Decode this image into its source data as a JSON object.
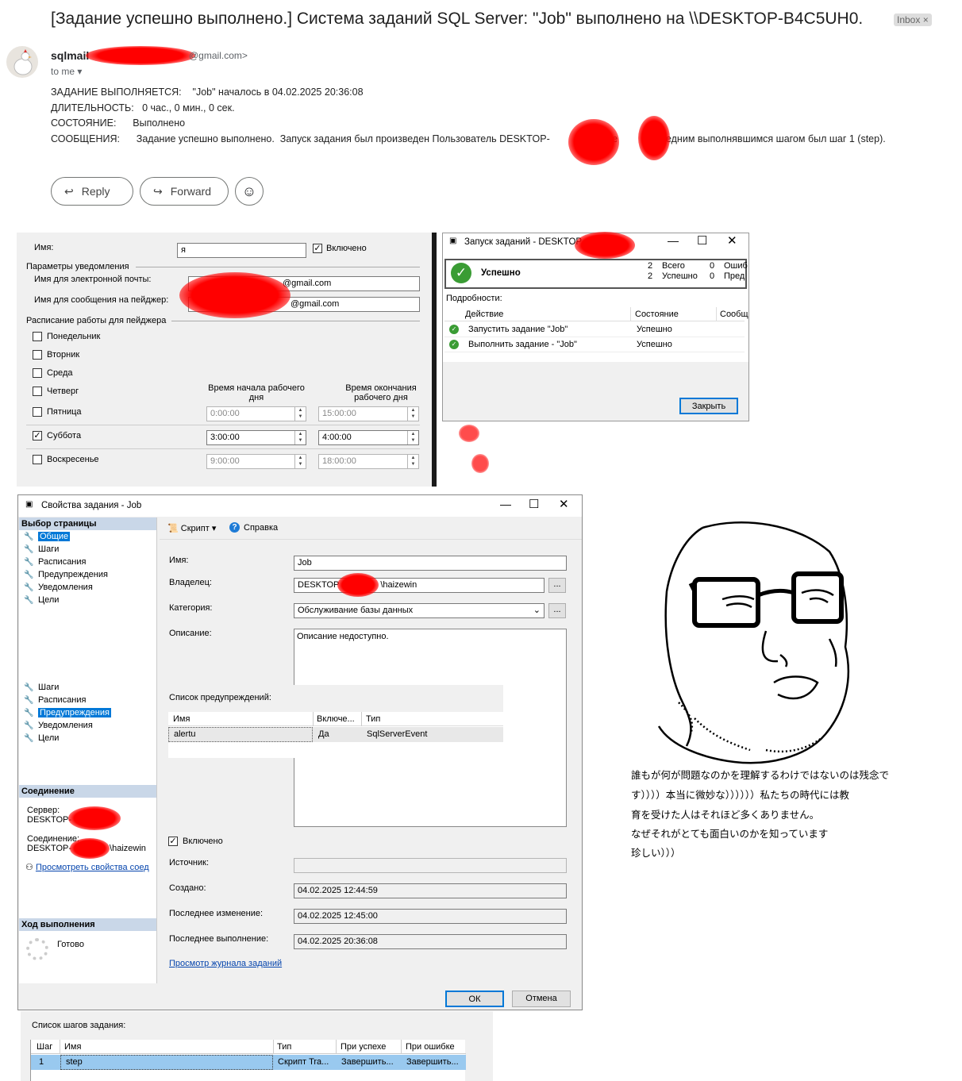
{
  "email": {
    "subject": "[Задание успешно выполнено.] Система заданий SQL Server: \"Job\" выполнено на \\\\DESKTOP-B4C5UH0.",
    "badge": "Inbox ×",
    "sender_name": "sqlmail",
    "sender_domain": "@gmail.com>",
    "to": "to me",
    "lines": [
      "ЗАДАНИЕ ВЫПОЛНЯЕТСЯ:    \"Job\" началось в 04.02.2025 20:36:08",
      "ДЛИТЕЛЬНОСТЬ:   0 час., 0 мин., 0 сек.",
      "СОСТОЯНИЕ:      Выполнено",
      "СООБЩЕНИЯ:      Задание успешно выполнено.  Запуск задания был произведен Пользователь DESKTOP-                haize         Последним выполнявшимся шагом был шаг 1 (step)."
    ],
    "reply": "Reply",
    "forward": "Forward"
  },
  "operator": {
    "name_label": "Имя:",
    "name_value": "я",
    "enabled": "Включено",
    "notify_group": "Параметры уведомления",
    "email_label": "Имя для электронной почты:",
    "email_value": "@gmail.com",
    "pager_label": "Имя для сообщения на пейджер:",
    "pager_value": "@gmail.com",
    "schedule_group": "Расписание работы для пейджера",
    "days": [
      "Понедельник",
      "Вторник",
      "Среда",
      "Четверг",
      "Пятница",
      "Суббота",
      "Воскресенье"
    ],
    "start_header": "Время начала рабочего дня",
    "end_header": "Время окончания рабочего дня",
    "rows": [
      {
        "start": "0:00:00",
        "end": "15:00:00"
      },
      {
        "start": "3:00:00",
        "end": "4:00:00"
      },
      {
        "start": "9:00:00",
        "end": "18:00:00"
      }
    ]
  },
  "run": {
    "title": "Запуск заданий - DESKTOP-",
    "status": "Успешно",
    "counts": [
      [
        "2",
        "Всего",
        "0",
        "Ошиб"
      ],
      [
        "2",
        "Успешно",
        "0",
        "Пред"
      ]
    ],
    "details": "Подробности:",
    "cols": [
      "Действие",
      "Состояние",
      "Сообщ"
    ],
    "rows": [
      [
        "Запустить задание \"Job\"",
        "Успешно"
      ],
      [
        "Выполнить задание - \"Job\"",
        "Успешно"
      ]
    ],
    "close": "Закрыть"
  },
  "props": {
    "title": "Свойства задания - Job",
    "nav_header": "Выбор страницы",
    "nav": [
      "Общие",
      "Шаги",
      "Расписания",
      "Предупреждения",
      "Уведомления",
      "Цели"
    ],
    "nav2": [
      "Шаги",
      "Расписания",
      "Предупреждения",
      "Уведомления",
      "Цели"
    ],
    "script": "Скрипт",
    "help": "Справка",
    "name_label": "Имя:",
    "name_value": "Job",
    "owner_label": "Владелец:",
    "owner_value_a": "DESKTOP",
    "owner_value_b": "\\haizewin",
    "category_label": "Категория:",
    "category_value": "Обслуживание базы данных",
    "desc_label": "Описание:",
    "desc_value": "Описание недоступно.",
    "alerts_label": "Список предупреждений:",
    "alert_cols": [
      "Имя",
      "Включе...",
      "Тип"
    ],
    "alert_row": [
      "alertu",
      "Да",
      "SqlServerEvent"
    ],
    "enabled": "Включено",
    "source_label": "Источник:",
    "created_label": "Создано:",
    "created_value": "04.02.2025 12:44:59",
    "modified_label": "Последнее изменение:",
    "modified_value": "04.02.2025 12:45:00",
    "lastrun_label": "Последнее выполнение:",
    "lastrun_value": "04.02.2025 20:36:08",
    "history_link": "Просмотр журнала заданий",
    "conn_header": "Соединение",
    "server_label": "Сервер:",
    "server_value": "DESKTOP-",
    "connection_label": "Соединение:",
    "connection_value_a": "DESKTOP-",
    "connection_value_b": "\\haizewin",
    "view_conn": "Просмотреть свойства соед",
    "progress_header": "Ход выполнения",
    "ready": "Готово",
    "ok": "ОК",
    "cancel": "Отмена"
  },
  "steps": {
    "label": "Список шагов задания:",
    "cols": [
      "Шаг",
      "Имя",
      "Тип",
      "При успехе",
      "При ошибке"
    ],
    "row": [
      "1",
      "step",
      "Скрипт Tra...",
      "Завершить...",
      "Завершить..."
    ]
  },
  "meme_text": [
    "誰もが何が問題なのかを理解するわけではないのは残念で",
    "す））））本当に微妙な））））））私たちの時代には教",
    "育を受けた人はそれほど多くありません。",
    "なぜそれがとても面白いのかを知っています",
    "珍しい）））"
  ]
}
